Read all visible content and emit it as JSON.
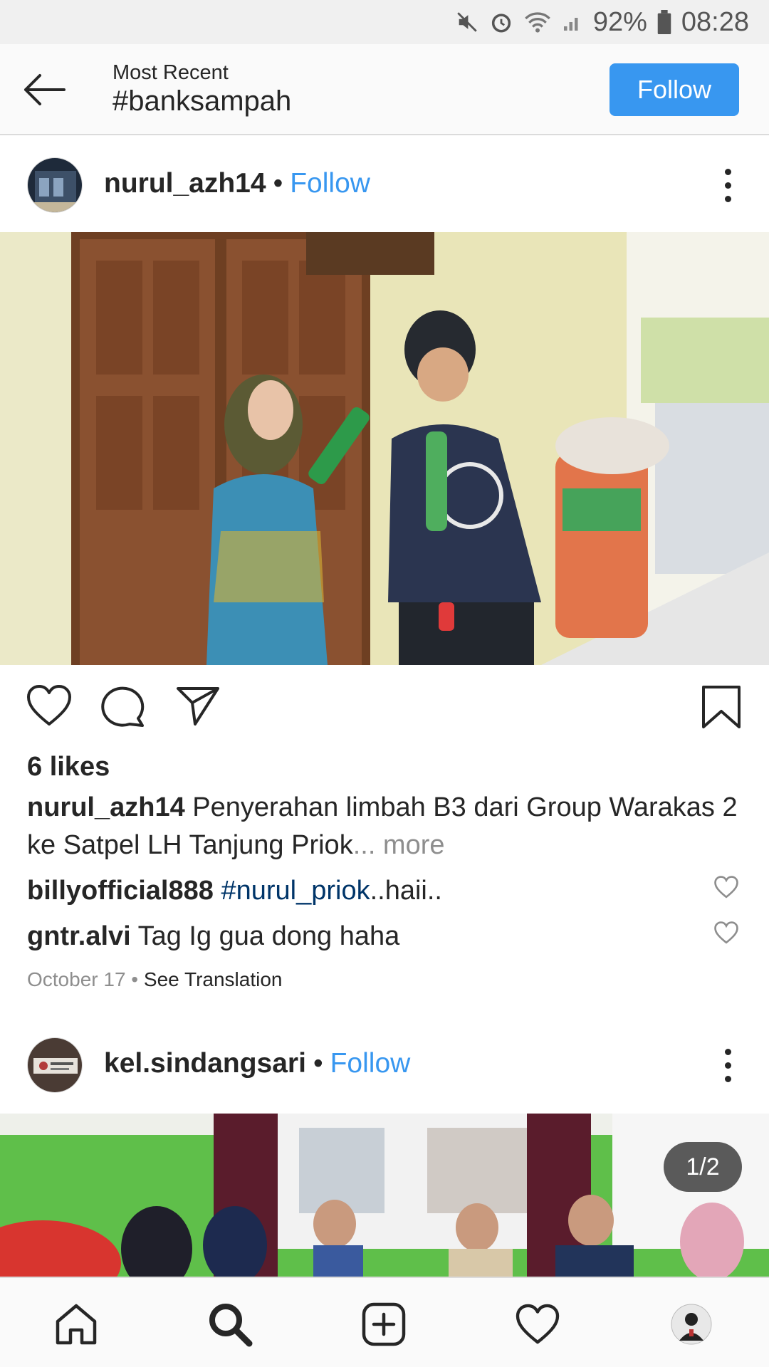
{
  "status_bar": {
    "battery": "92%",
    "time": "08:28"
  },
  "header": {
    "subtitle": "Most Recent",
    "title": "#banksampah",
    "follow_label": "Follow"
  },
  "posts": [
    {
      "username": "nurul_azh14",
      "separator": "•",
      "follow_label": "Follow",
      "likes": "6 likes",
      "caption_user": "nurul_azh14",
      "caption_text": " Penyerahan limbah B3 dari Group Warakas 2 ke Satpel LH Tanjung Priok",
      "caption_more": "... more",
      "comments": [
        {
          "user": "billyofficial888",
          "hashtag": "#nurul_priok",
          "text": "..haii.."
        },
        {
          "user": "gntr.alvi",
          "hashtag": "",
          "text": " Tag Ig gua dong haha"
        }
      ],
      "date": "October 17",
      "meta_sep": " • ",
      "see_translation": "See Translation"
    },
    {
      "username": "kel.sindangsari",
      "separator": "•",
      "follow_label": "Follow",
      "carousel_counter": "1/2"
    }
  ],
  "colors": {
    "accent": "#3897f0",
    "hashtag": "#003569",
    "muted": "#8e8e8e"
  },
  "icons": [
    "back-arrow-icon",
    "heart-icon",
    "comment-icon",
    "share-icon",
    "bookmark-icon",
    "home-icon",
    "search-icon",
    "add-post-icon",
    "activity-heart-icon",
    "profile-avatar-icon"
  ]
}
